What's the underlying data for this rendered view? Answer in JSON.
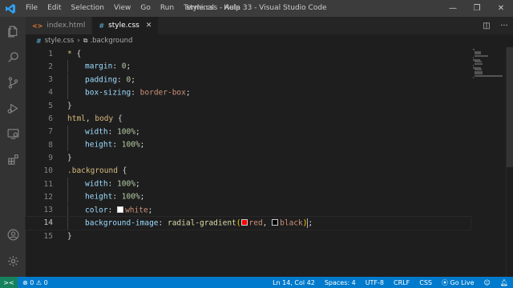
{
  "titlebar": {
    "menu": [
      "File",
      "Edit",
      "Selection",
      "View",
      "Go",
      "Run",
      "Terminal",
      "Help"
    ],
    "title": "style.css - Aula 33 - Visual Studio Code",
    "controls": [
      "—",
      "❐",
      "✕"
    ]
  },
  "tabs": [
    {
      "label": "index.html",
      "icon": "<>",
      "icon_color": "#e37933",
      "active": false
    },
    {
      "label": "style.css",
      "icon": "#",
      "icon_color": "#519aba",
      "active": true
    }
  ],
  "breadcrumb": {
    "file": "style.css",
    "symbol": ".background"
  },
  "editor": {
    "current_line": 14,
    "lines": [
      {
        "n": "1",
        "tokens": [
          [
            "sel",
            "* "
          ],
          [
            "pun",
            "{"
          ]
        ],
        "indent": 0
      },
      {
        "n": "2",
        "tokens": [
          [
            "prop",
            "margin"
          ],
          [
            "pun",
            ": "
          ],
          [
            "num",
            "0"
          ],
          [
            "pun",
            ";"
          ]
        ],
        "indent": 1
      },
      {
        "n": "3",
        "tokens": [
          [
            "prop",
            "padding"
          ],
          [
            "pun",
            ": "
          ],
          [
            "num",
            "0"
          ],
          [
            "pun",
            ";"
          ]
        ],
        "indent": 1
      },
      {
        "n": "4",
        "tokens": [
          [
            "prop",
            "box-sizing"
          ],
          [
            "pun",
            ": "
          ],
          [
            "val",
            "border-box"
          ],
          [
            "pun",
            ";"
          ]
        ],
        "indent": 1
      },
      {
        "n": "5",
        "tokens": [
          [
            "pun",
            "}"
          ]
        ],
        "indent": 0
      },
      {
        "n": "6",
        "tokens": [
          [
            "sel",
            "html"
          ],
          [
            "pun",
            ", "
          ],
          [
            "sel",
            "body"
          ],
          [
            "pun",
            " {"
          ]
        ],
        "indent": 0
      },
      {
        "n": "7",
        "tokens": [
          [
            "prop",
            "width"
          ],
          [
            "pun",
            ": "
          ],
          [
            "num",
            "100%"
          ],
          [
            "pun",
            ";"
          ]
        ],
        "indent": 1
      },
      {
        "n": "8",
        "tokens": [
          [
            "prop",
            "height"
          ],
          [
            "pun",
            ": "
          ],
          [
            "num",
            "100%"
          ],
          [
            "pun",
            ";"
          ]
        ],
        "indent": 1
      },
      {
        "n": "9",
        "tokens": [
          [
            "pun",
            "}"
          ]
        ],
        "indent": 0
      },
      {
        "n": "10",
        "tokens": [
          [
            "sel",
            ".background"
          ],
          [
            "pun",
            " {"
          ]
        ],
        "indent": 0
      },
      {
        "n": "11",
        "tokens": [
          [
            "prop",
            "width"
          ],
          [
            "pun",
            ": "
          ],
          [
            "num",
            "100%"
          ],
          [
            "pun",
            ";"
          ]
        ],
        "indent": 1
      },
      {
        "n": "12",
        "tokens": [
          [
            "prop",
            "height"
          ],
          [
            "pun",
            ": "
          ],
          [
            "num",
            "100%"
          ],
          [
            "pun",
            ";"
          ]
        ],
        "indent": 1
      },
      {
        "n": "13",
        "tokens": [
          [
            "prop",
            "color"
          ],
          [
            "pun",
            ": "
          ],
          [
            "swatch",
            "#ffffff"
          ],
          [
            "val",
            "white"
          ],
          [
            "pun",
            ";"
          ]
        ],
        "indent": 1
      },
      {
        "n": "14",
        "tokens": [
          [
            "prop",
            "background-image"
          ],
          [
            "pun",
            ": "
          ],
          [
            "fn",
            "radial-gradient"
          ],
          [
            "brk",
            "("
          ],
          [
            "swatch",
            "#ff0000"
          ],
          [
            "val",
            "red"
          ],
          [
            "pun",
            ", "
          ],
          [
            "swatch",
            "#000000"
          ],
          [
            "val",
            "black"
          ],
          [
            "brk",
            ")"
          ],
          [
            "cursor",
            ""
          ],
          [
            "pun",
            ";"
          ]
        ],
        "indent": 1
      },
      {
        "n": "15",
        "tokens": [
          [
            "pun",
            "}"
          ]
        ],
        "indent": 0
      }
    ]
  },
  "statusbar": {
    "remote": "><",
    "problems": "⊗ 0 ⚠ 0",
    "position": "Ln 14, Col 42",
    "spaces": "Spaces: 4",
    "encoding": "UTF-8",
    "eol": "CRLF",
    "language": "CSS",
    "golive": "⦿ Go Live"
  },
  "colors": {
    "accent": "#007acc",
    "remote": "#16825d"
  }
}
